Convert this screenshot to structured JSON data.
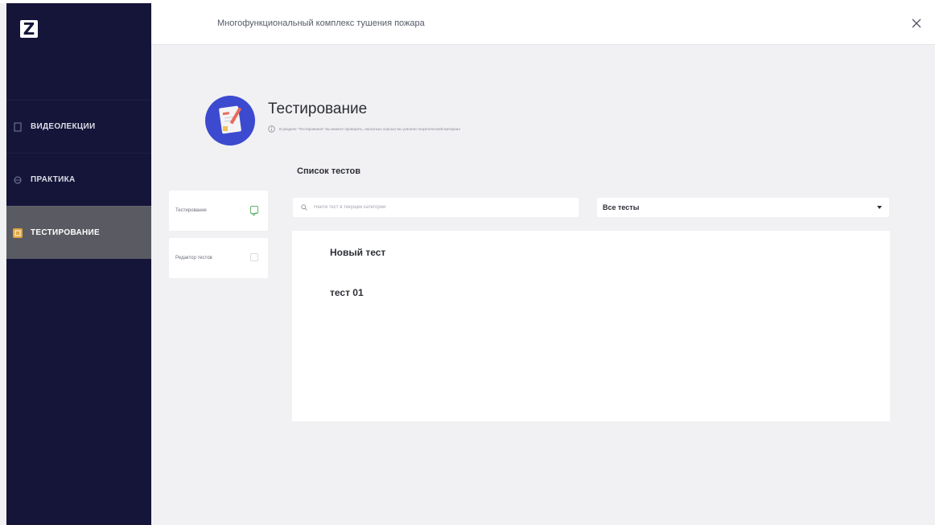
{
  "app": {
    "title": "Многофункциональный комплекс тушения пожара",
    "logo": "Z"
  },
  "sidebar": {
    "items": [
      {
        "label": "ВИДЕОЛЕКЦИИ",
        "icon": "video-icon",
        "active": false
      },
      {
        "label": "ПРАКТИКА",
        "icon": "practice-icon",
        "active": false
      },
      {
        "label": "ТЕСТИРОВАНИЕ",
        "icon": "testing-icon",
        "active": true
      }
    ]
  },
  "page": {
    "title": "Тестирование",
    "info": "В разделе \"Тестирование\" вы можете проверить, насколько хорошо вы усвоили теоретический материал"
  },
  "tabs": [
    {
      "label": "Тестирование",
      "checked": true
    },
    {
      "label": "Редактор тестов",
      "checked": false
    }
  ],
  "list": {
    "title": "Список тестов",
    "items": [
      "Новый тест",
      "тест 01"
    ]
  },
  "search": {
    "placeholder": "Найти тест в текущей категории",
    "value": ""
  },
  "filter": {
    "selected": "Все тесты"
  },
  "colors": {
    "sidebar_bg": "#15153a",
    "active_item_bg": "#5a5b62",
    "accent": "#e0a63d",
    "avatar_bg": "#3c4ad0",
    "check_green": "#5cb56a"
  }
}
